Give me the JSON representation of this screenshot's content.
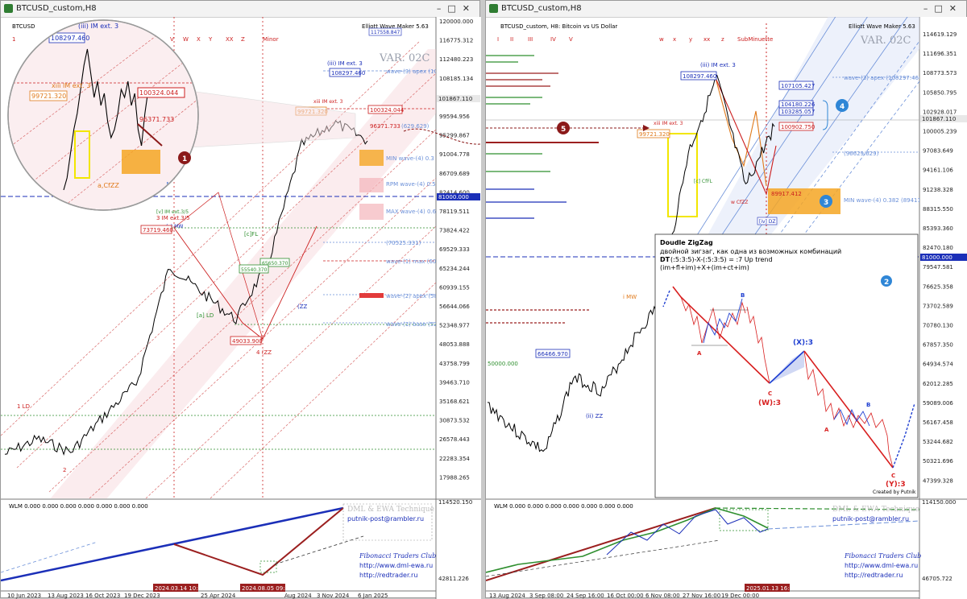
{
  "left": {
    "title": "BTCUSD_custom,H8",
    "chart_symbol": "BTCUSD",
    "indicator": "Elliott Wave Maker 5.63",
    "var_label": "VAR. 02C",
    "degree_row": [
      "1",
      "V",
      "W",
      "X",
      "Y",
      "XX",
      "Z",
      "Minor"
    ],
    "price_ticks": [
      "120000.000",
      "116775.312",
      "112480.223",
      "108185.134",
      "103890.045",
      "99594.956",
      "95299.867",
      "91004.778",
      "86709.689",
      "82414.600",
      "78119.511",
      "73824.422",
      "69529.333",
      "65234.244",
      "60939.155",
      "56644.066",
      "52348.977",
      "48053.888",
      "43758.799",
      "39463.710",
      "35168.621",
      "30873.532",
      "26578.443",
      "22283.354",
      "17988.265"
    ],
    "time_ticks": [
      "10 Jun 2023",
      "13 Aug 2023",
      "16 Oct 2023",
      "19 Dec 2023",
      "25 Apr 2024",
      "Aug 2024",
      "3 Nov 2024",
      "6 Jan 2025"
    ],
    "time_highlights": [
      "2024.03.14 10:05",
      "2024.08.05 09:24"
    ],
    "price_badges": {
      "current": "101867.110",
      "level_81000": "81000.000",
      "top_box": "117558.847"
    },
    "labels": {
      "high_108297": "108297.460",
      "im_ext3": "(iii) IM ext. 3",
      "xiii_im_ext3": "xiii IM ext. 3",
      "level_99721": "99721.320",
      "level_100324": "100324.044",
      "level_96371": "96371.733",
      "level_73719": "73719.460",
      "level_49033": "49033.900",
      "level_65650": "65650.370",
      "level_55540": "55540.370",
      "im_ext_35": "3 IM ext.3/5",
      "v_im_ext35": "[v] IM ext.3/5",
      "v_mw": "(v) MW",
      "a_ld": "[a] LD",
      "four_zz": "4 (ZZ",
      "one_ld": "1 LD",
      "two": "2",
      "c_fl": "[c]FL",
      "zz_r": "(ZZ",
      "wave3_apex": "wave-(3) apex (10",
      "min_wave4": "MIN wave-(4) 0.3",
      "rpm_wave4": "RPM wave-(4) 0.5",
      "max_wave4": "MAX wave-(4) 0.6",
      "level_70525": "(70525.331)",
      "wave2_apex": "wave-(2) apex (58",
      "wave1_base": "wave-(1) base (52",
      "wave1_max": "wave-(1) max (60",
      "paren_629": "(629.629)",
      "zoom_min": "MIN",
      "zoom_cfzz": "a,CfZZ"
    },
    "callout_1": "1",
    "wlm": {
      "label": "WLM 0.000 0.000 0.000 0.000 0.000 0.000 0.000",
      "ticks": [
        "114520.150",
        "42811.226"
      ],
      "brand_title": "DML & EWA Technique",
      "email": "putnik-post@rambler.ru",
      "club": "Fibonacci   Traders   Club",
      "site1": "http://www.dml-ewa.ru",
      "site2": "http://redtrader.ru"
    }
  },
  "right": {
    "title": "BTCUSD_custom,H8",
    "subtitle": "BTCUSD_custom, H8:  Bitcoin vs US Dollar",
    "indicator": "Elliott Wave Maker 5.63",
    "var_label": "VAR. 02C",
    "degree_row": [
      "I",
      "II",
      "III",
      "IV",
      "V",
      "w",
      "x",
      "y",
      "xx",
      "z",
      "SubMinuette"
    ],
    "price_ticks": [
      "114619.129",
      "111696.351",
      "108773.573",
      "105850.795",
      "102928.017",
      "100005.239",
      "97083.649",
      "94161.106",
      "91238.328",
      "88315.550",
      "85393.360",
      "82470.180",
      "79547.581",
      "76625.358",
      "73702.589",
      "70780.130",
      "67857.350",
      "64934.574",
      "62012.285",
      "59089.006",
      "56167.458",
      "53244.682",
      "50321.696",
      "47399.328"
    ],
    "time_ticks": [
      "13 Aug 2024",
      "3 Sep 08:00",
      "24 Sep 16:00",
      "16 Oct 00:00",
      "6 Nov 08:00",
      "27 Nov 16:00",
      "19 Dec 00:00"
    ],
    "time_highlight": "2025.01.13 16:35",
    "price_badges": {
      "current": "101867.110",
      "level_81000": "81000.000"
    },
    "labels": {
      "im_ext3": "(iii) IM ext. 3",
      "high_108297": "108297.460",
      "xiii": "xiii IM ext. 3",
      "level_99721": "99721.320",
      "level_107105": "107105.427",
      "level_104180": "104180.226",
      "level_103285": "103285.057",
      "level_100902": "100902.750",
      "paren_96629": "(96629.629)",
      "wave3_apex": "wave-(3) apex (108297.460",
      "min_wave4": "MIN wave-(4) 0.382 (89411",
      "level_89917": "89917.412",
      "level_66466": "66466.970",
      "level_50000": "50000.000",
      "i_mw": "i MW",
      "w_cfzz": "w CfZZ",
      "ii_zz": "(ii) ZZ",
      "iv_dz": "[iv] DZ",
      "c_cffl": "[c] CfFL"
    },
    "callouts": [
      "2",
      "3",
      "4",
      "5"
    ],
    "info_panel": {
      "title": "Doudle ZigZag",
      "ru": "двойной зигзаг, как одна из возможных комбинаций",
      "formula_dt": "DT",
      "formula_rest": "(:5:3:5)-X-(:5:3:5) = :7 Up trend",
      "formula2": "(im+fl+im)+X+(im+ct+im)",
      "w3": "(W):3",
      "x3": "(X):3",
      "y3": "(Y):3",
      "A": "A",
      "B": "B",
      "C": "C",
      "created": "Created by Putnik"
    },
    "wlm": {
      "label": "WLM 0.000 0.000 0.000 0.000 0.000 0.000 0.000",
      "ticks": [
        "114150.000",
        "46705.722"
      ],
      "brand_title": "DML & EWA Technique",
      "email": "putnik-post@rambler.ru",
      "club": "Fibonacci   Traders   Club",
      "site1": "http://www.dml-ewa.ru",
      "site2": "http://redtrader.ru"
    }
  },
  "colors": {
    "bull": "#000000",
    "wave_red": "#cc1f1f",
    "wave_blue": "#1f3fd1",
    "fib_pink": "#f3c9cf",
    "target_orange": "#f5a623",
    "callout_red": "#8b1a1a",
    "callout_blue": "#2f86d6",
    "wlm_blue": "#1b2fb8",
    "wlm_red": "#9b1f1f",
    "wlm_green": "#2f8f2f"
  },
  "chart_data": [
    {
      "type": "line",
      "title": "BTCUSD_custom,H8",
      "ylim": [
        17988.265,
        120000.0
      ],
      "x": [
        "10 Jun 2023",
        "13 Aug 2023",
        "16 Oct 2023",
        "19 Dec 2023",
        "25 Apr 2024",
        "Aug 2024",
        "3 Nov 2024",
        "6 Jan 2025"
      ],
      "series": [
        {
          "values": [
            26000,
            29500,
            26500,
            34500,
            42000,
            68000,
            62000,
            56000,
            69000,
            95000,
            100000,
            96000
          ]
        }
      ]
    },
    {
      "type": "line",
      "title": "BTCUSD_custom, H8:  Bitcoin vs US Dollar",
      "ylim": [
        47399.328,
        114619.129
      ],
      "x": [
        "13 Aug 2024",
        "3 Sep 08:00",
        "24 Sep 16:00",
        "16 Oct 00:00",
        "6 Nov 08:00",
        "27 Nov 16:00",
        "19 Dec 00:00"
      ],
      "series": [
        {
          "values": [
            60000,
            56000,
            53000,
            64000,
            62000,
            69000,
            75000,
            97000,
            108000,
            92000,
            101000
          ]
        }
      ]
    }
  ]
}
